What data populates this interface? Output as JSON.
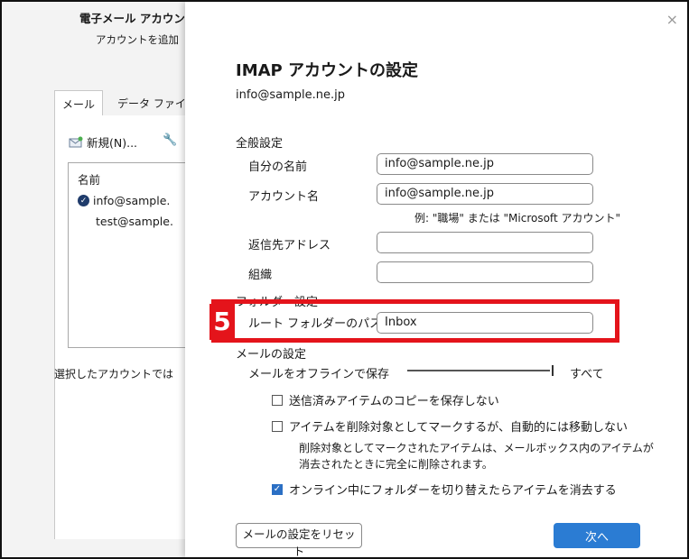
{
  "background_window": {
    "title": "電子メール アカウン",
    "subtitle": "アカウントを追加",
    "tabs": [
      "メール",
      "データ ファイ/"
    ],
    "new_button": "新規(N)...",
    "list_header": "名前",
    "accounts": [
      "info@sample.",
      "test@sample."
    ],
    "selected_note": "選択したアカウントでは"
  },
  "dialog": {
    "title": "IMAP アカウントの設定",
    "email": "info@sample.ne.jp",
    "general_section": "全般設定",
    "name_label": "自分の名前",
    "name_value": "info@sample.ne.jp",
    "account_label": "アカウント名",
    "account_value": "info@sample.ne.jp",
    "account_hint": "例: \"職場\" または \"Microsoft アカウント\"",
    "reply_label": "返信先アドレス",
    "reply_value": "",
    "org_label": "組織",
    "org_value": "",
    "folder_section": "フォルダー設定",
    "root_folder_label": "ルート フォルダーのパス",
    "root_folder_value": "Inbox",
    "mail_section": "メールの設定",
    "offline_label": "メールをオフラインで保存",
    "offline_value": "すべて",
    "checkbox1": "送信済みアイテムのコピーを保存しない",
    "checkbox2": "アイテムを削除対象としてマークするが、自動的には移動しない",
    "checkbox2_note_line1": "削除対象としてマークされたアイテムは、メールボックス内のアイテムが",
    "checkbox2_note_line2": "消去されたときに完全に削除されます。",
    "checkbox3": "オンライン中にフォルダーを切り替えたらアイテムを消去する",
    "reset_button": "メールの設定をリセット",
    "next_button": "次へ",
    "close_symbol": "×"
  },
  "annotation": {
    "number": "5",
    "color": "#e4141b"
  },
  "colors": {
    "accent": "#2b7cd3"
  }
}
